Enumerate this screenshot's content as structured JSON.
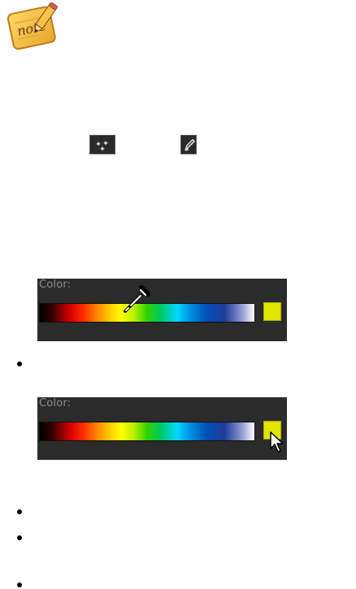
{
  "panels": {
    "top": {
      "label": "Color:",
      "swatch_color": "#e2e600",
      "cursor": "eyedropper-icon"
    },
    "bottom": {
      "label": "Color:",
      "swatch_color": "#e2e600",
      "cursor": "arrow-cursor-icon"
    }
  },
  "icons": {
    "note_badge": "note-badge-icon",
    "eyedropper_button": "eyedropper-icon",
    "pencil_button": "pencil-icon"
  },
  "colors": {
    "panel_bg": "#2b2b2b",
    "label_color": "#8f8f8f",
    "bullet": "#000000",
    "note_badge_bg": "#f3b42c"
  }
}
